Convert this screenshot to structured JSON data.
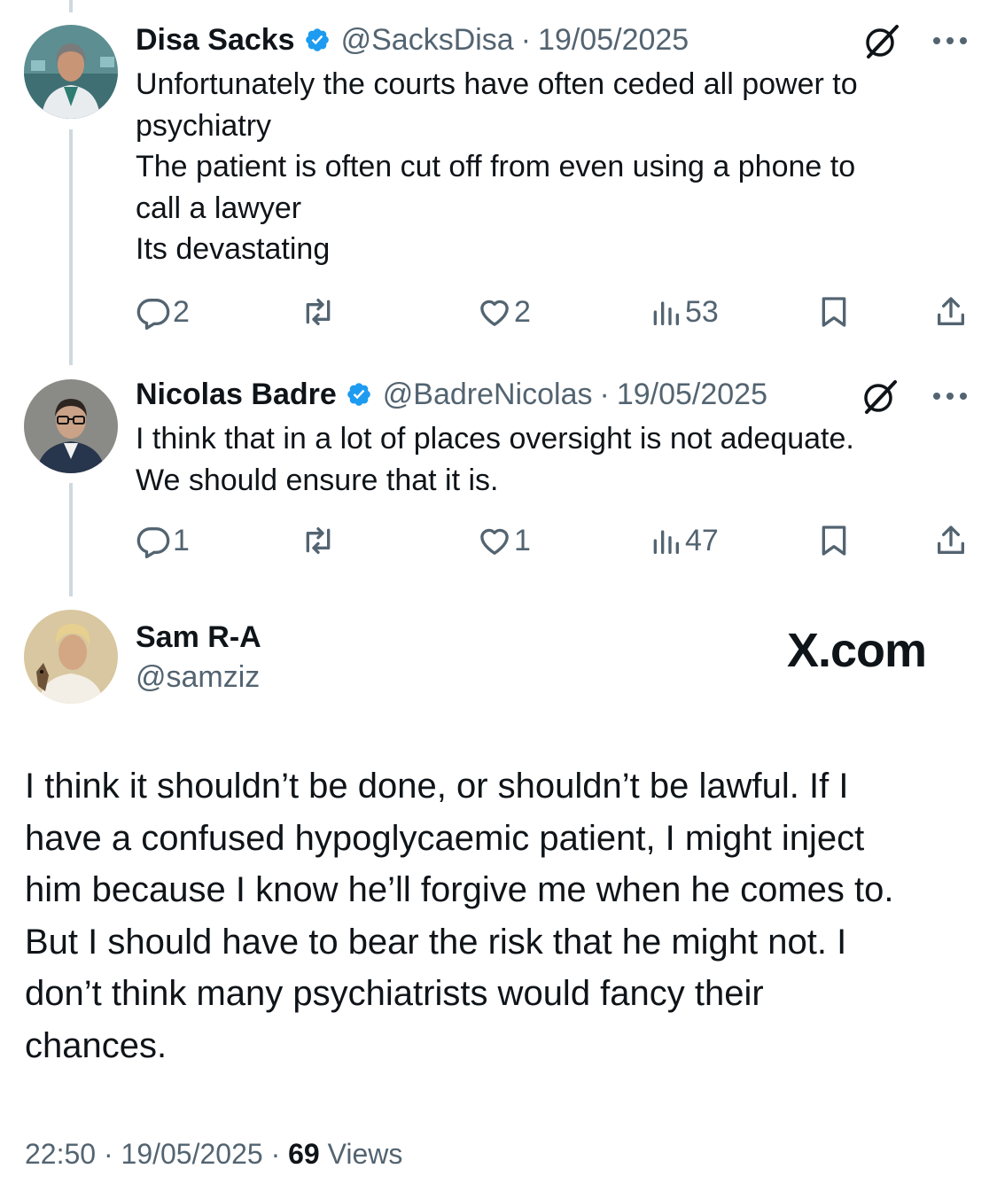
{
  "replies": [
    {
      "name": "Disa Sacks",
      "handle": "@SacksDisa",
      "separator": "·",
      "date": "19/05/2025",
      "text_lines": [
        "Unfortunately the courts have often ceded all power to",
        "psychiatry",
        "The patient is often cut off from even using a phone to",
        "call a lawyer",
        "Its devastating"
      ],
      "replies_count": "2",
      "likes_count": "2",
      "views_count": "53"
    },
    {
      "name": "Nicolas Badre",
      "handle": "@BadreNicolas",
      "separator": "·",
      "date": "19/05/2025",
      "text_lines": [
        "I think that in a lot of places oversight is not adequate.",
        "We should ensure that it is."
      ],
      "replies_count": "1",
      "likes_count": "1",
      "views_count": "47"
    }
  ],
  "main_post": {
    "name": "Sam R-A",
    "handle": "@samziz",
    "watermark": "X.com",
    "text_lines": [
      "I think it shouldn’t be done, or shouldn’t be lawful. If I",
      "have a confused hypoglycaemic patient, I might inject",
      "him because I know he’ll forgive me when he comes to.",
      "But I should have to bear the risk that he might not. I",
      "don’t think many psychiatrists would fancy their",
      "chances."
    ],
    "time": "22:50",
    "separator": "·",
    "date": "19/05/2025",
    "separator2": "·",
    "views_count": "69",
    "views_label": "Views"
  },
  "icons": {
    "verified": "verified-badge-icon",
    "grok": "grok-icon",
    "more": "more-icon",
    "reply": "reply-icon",
    "repost": "repost-icon",
    "like": "heart-icon",
    "views": "views-icon",
    "bookmark": "bookmark-icon",
    "share": "share-icon"
  },
  "colors": {
    "verified_blue": "#1d9bf0",
    "secondary_text": "#536471",
    "thread_line": "#cfd9de"
  }
}
